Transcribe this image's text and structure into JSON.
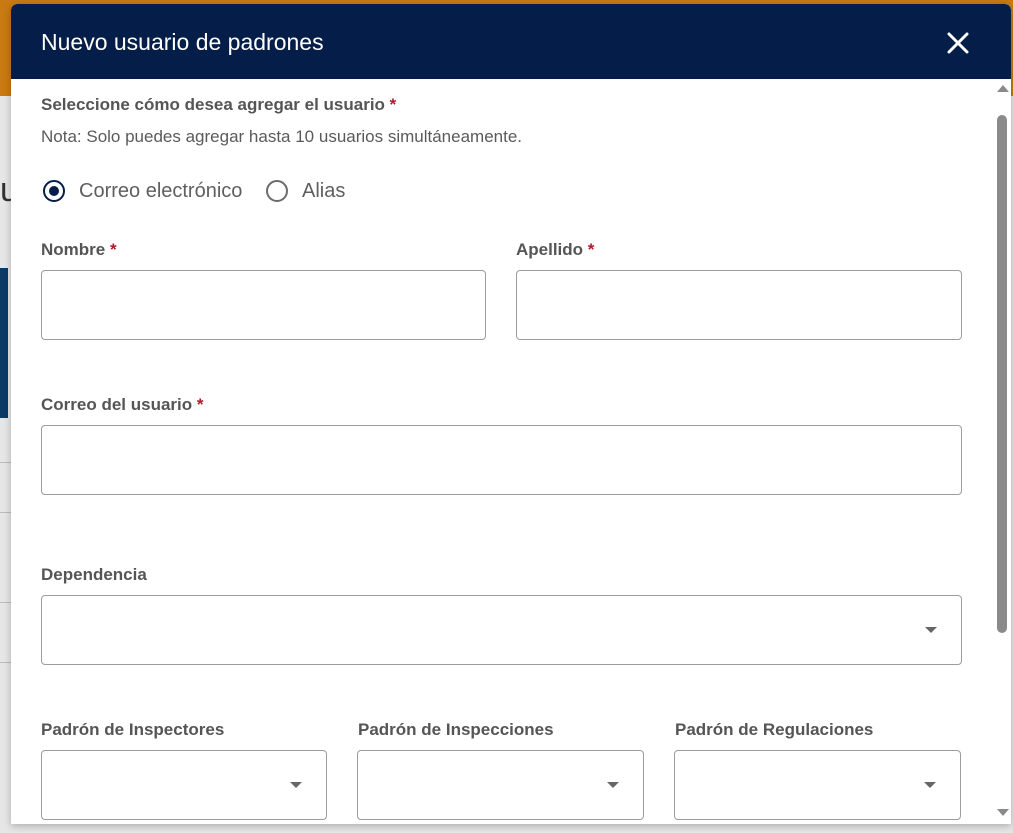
{
  "dialog": {
    "title": "Nuevo usuario de padrones",
    "close_icon": "close-icon"
  },
  "add_method": {
    "label": "Seleccione cómo desea agregar el usuario",
    "required_mark": "*",
    "note": "Nota: Solo puedes agregar hasta 10 usuarios simultáneamente.",
    "options": [
      {
        "label": "Correo electrónico",
        "selected": true
      },
      {
        "label": "Alias",
        "selected": false
      }
    ]
  },
  "fields": {
    "nombre": {
      "label": "Nombre",
      "required_mark": "*",
      "value": ""
    },
    "apellido": {
      "label": "Apellido",
      "required_mark": "*",
      "value": ""
    },
    "correo": {
      "label": "Correo del usuario",
      "required_mark": "*",
      "value": ""
    },
    "dependencia": {
      "label": "Dependencia",
      "value": ""
    },
    "padron_inspectores": {
      "label": "Padrón de Inspectores",
      "value": ""
    },
    "padron_inspecciones": {
      "label": "Padrón de Inspecciones",
      "value": ""
    },
    "padron_regulaciones": {
      "label": "Padrón de Regulaciones",
      "value": ""
    }
  },
  "colors": {
    "header_bg": "#041e49",
    "required": "#b0182a",
    "backdrop_accent": "#c97a12"
  },
  "backdrop": {
    "partial_text": "u"
  }
}
